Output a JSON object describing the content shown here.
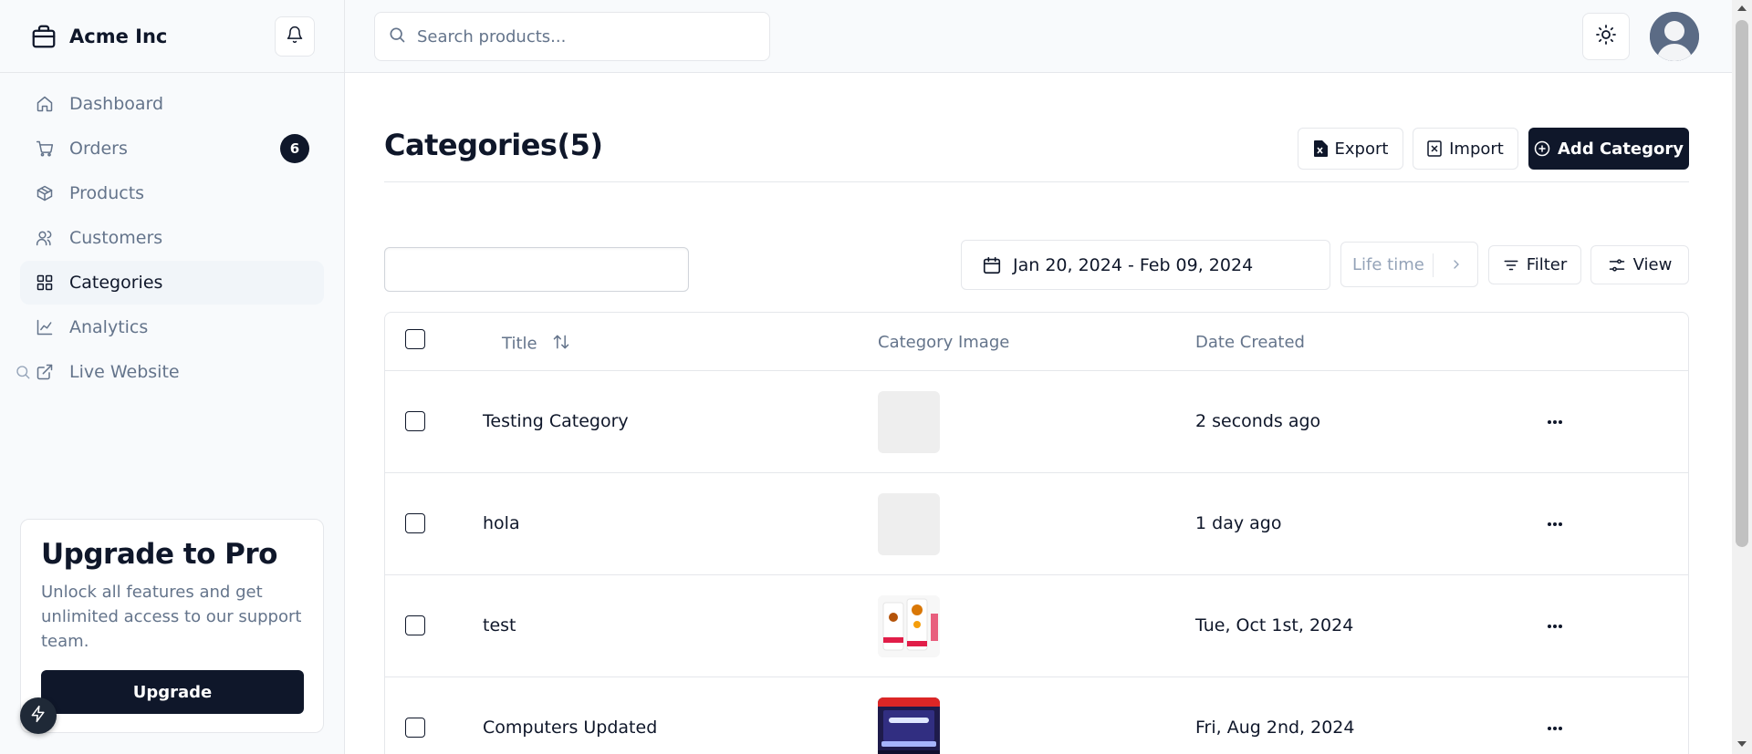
{
  "brand": {
    "name": "Acme Inc"
  },
  "sidebar": {
    "items": [
      {
        "label": "Dashboard",
        "icon": "home-icon"
      },
      {
        "label": "Orders",
        "icon": "cart-icon",
        "badge": "6"
      },
      {
        "label": "Products",
        "icon": "package-icon"
      },
      {
        "label": "Customers",
        "icon": "users-icon"
      },
      {
        "label": "Categories",
        "icon": "grid-icon",
        "active": true
      },
      {
        "label": "Analytics",
        "icon": "chart-line-icon"
      },
      {
        "label": "Live Website",
        "icon": "external-link-icon"
      }
    ],
    "upgrade": {
      "title": "Upgrade to Pro",
      "description": "Unlock all features and get unlimited access to our support team.",
      "button_label": "Upgrade"
    }
  },
  "header": {
    "search_placeholder": "Search products...",
    "search_value": ""
  },
  "page": {
    "title": "Categories(5)",
    "export_label": "Export",
    "import_label": "Import",
    "add_label": "Add Category"
  },
  "toolbar": {
    "filter_value": "",
    "date_range": "Jan 20, 2024 - Feb 09, 2024",
    "lifetime_label": "Life time",
    "filter_label": "Filter",
    "view_label": "View"
  },
  "table": {
    "columns": {
      "title": "Title",
      "image": "Category Image",
      "date": "Date Created"
    },
    "rows": [
      {
        "title": "Testing Category",
        "date": "2 seconds ago",
        "image": "placeholder"
      },
      {
        "title": "hola",
        "date": "1 day ago",
        "image": "placeholder"
      },
      {
        "title": "test",
        "date": "Tue, Oct 1st, 2024",
        "image": "food-app"
      },
      {
        "title": "Computers Updated",
        "date": "Fri, Aug 2nd, 2024",
        "image": "laptop"
      }
    ]
  },
  "colors": {
    "primary": "#0f172a",
    "muted": "#64748b",
    "border": "#e5e7eb",
    "sidebar_bg": "#f8fafc"
  }
}
